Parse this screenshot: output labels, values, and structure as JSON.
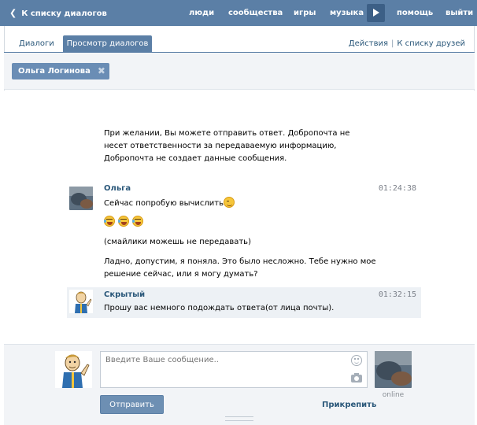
{
  "topbar": {
    "back_label": "К списку диалогов",
    "nav": [
      "люди",
      "сообщества",
      "игры",
      "музыка"
    ],
    "help": "помощь",
    "logout": "выйти"
  },
  "tabs": {
    "dialogs": "Диалоги",
    "view_dialogs": "Просмотр диалогов",
    "actions": "Действия",
    "friends_list": "К списку друзей"
  },
  "filter": {
    "chip_label": "Ольга Логинова"
  },
  "notice": "При желании, Вы можете отправить ответ. Добропочта не несет ответственности за передаваемую информацию, Добропочта не создает данные сообщения.",
  "messages": [
    {
      "author": "Ольга",
      "time": "01:24:38",
      "lines": [
        "Сейчас попробую вычислить",
        "",
        "(смайлики можешь не передавать)",
        "Ладно, допустим, я поняла. Это было несложно. Тебе нужно мое",
        "решение сейчас, или я могу думать?"
      ]
    },
    {
      "author": "Скрытый",
      "time": "01:32:15",
      "lines": [
        "Прошу вас немного подождать ответа(от лица почты)."
      ]
    }
  ],
  "compose": {
    "placeholder": "Введите Ваше сообщение..",
    "send_label": "Отправить",
    "attach_label": "Прикрепить",
    "status": "online"
  },
  "colors": {
    "header": "#5b7fa6",
    "link": "#2b587a",
    "panel": "#f2f4f7",
    "highlight": "#edf1f5"
  }
}
